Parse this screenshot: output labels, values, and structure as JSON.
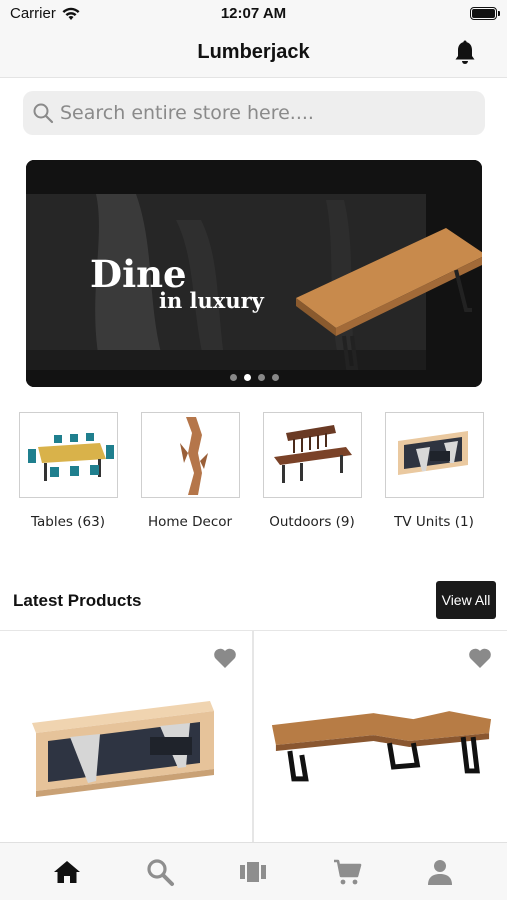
{
  "status": {
    "carrier": "Carrier",
    "time": "12:07 AM"
  },
  "nav": {
    "title": "Lumberjack"
  },
  "search": {
    "placeholder": "Search entire store here...."
  },
  "banner": {
    "headline": "Dine",
    "sub": "in luxury",
    "slide_count": 4,
    "active_slide": 2
  },
  "categories": [
    {
      "label": "Tables (63)"
    },
    {
      "label": "Home Decor"
    },
    {
      "label": "Outdoors (9)"
    },
    {
      "label": "TV Units (1)"
    }
  ],
  "latest": {
    "title": "Latest Products",
    "view_all": "View All"
  },
  "colors": {
    "accent": "#1a1a1a",
    "wood": "#c88a4c",
    "tab_active": "#111111",
    "tab_inactive": "#8e8e8e"
  },
  "tabs": [
    {
      "icon": "home-icon",
      "active": true
    },
    {
      "icon": "search-icon",
      "active": false
    },
    {
      "icon": "catalog-icon",
      "active": false
    },
    {
      "icon": "cart-icon",
      "active": false
    },
    {
      "icon": "profile-icon",
      "active": false
    }
  ]
}
